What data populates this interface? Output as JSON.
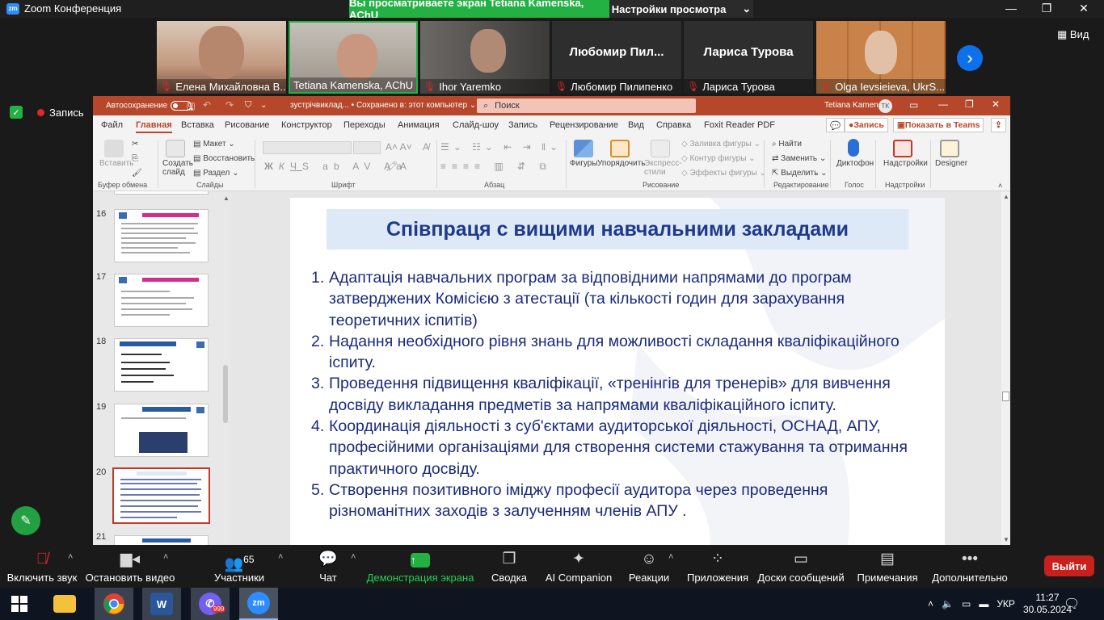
{
  "zoom": {
    "app_title": "Zoom Конференция",
    "share_banner": "Вы просматриваете экран Tetiana Kamenska, AChU",
    "view_settings": "Настройки просмотра",
    "view_button": "Вид",
    "recording": "Запись"
  },
  "participants": [
    {
      "name": "Елена Михайловна В...",
      "video": true,
      "bg": "#c9a58a"
    },
    {
      "name": "Tetiana Kamenska, AChU",
      "video": true,
      "bg": "#b9b0a0"
    },
    {
      "name": "Ihor Yaremko",
      "video": true,
      "bg": "#4d4a47"
    },
    {
      "name": "Любомир Пилипенко",
      "display": "Любомир  Пил...",
      "video": false
    },
    {
      "name": "Лариса Турова",
      "display": "Лариса Турова",
      "video": false
    },
    {
      "name": "Olga Ievsieieva, UkrS...",
      "video": true,
      "bg": "#c27a3d"
    }
  ],
  "ppt": {
    "autosave": "Автосохранение",
    "filename": "зустрічвиклад... • Сохранено в: этот компьютер",
    "search": "Поиск",
    "user": "Tetiana Kamenska",
    "initials": "TK",
    "tabs": [
      "Файл",
      "Главная",
      "Вставка",
      "Рисование",
      "Конструктор",
      "Переходы",
      "Анимация",
      "Слайд-шоу",
      "Запись",
      "Рецензирование",
      "Вид",
      "Справка",
      "Foxit Reader PDF"
    ],
    "record_btn": "Запись",
    "teams_btn": "Показать в Teams",
    "ribbon": {
      "paste": "Вставить",
      "clipboard": "Буфер обмена",
      "create_slide": "Создать слайд",
      "layout": "Макет",
      "restore": "Восстановить",
      "section": "Раздел",
      "slides": "Слайды",
      "font": "Шрифт",
      "paragraph": "Абзац",
      "shapes": "Фигуры",
      "arrange": "Упорядочить",
      "express_styles": "Экспресс-стили",
      "shape_fill": "Заливка фигуры",
      "shape_outline": "Контур фигуры",
      "shape_effects": "Эффекты фигуры",
      "drawing": "Рисование",
      "find": "Найти",
      "replace": "Заменить",
      "select": "Выделить",
      "editing": "Редактирование",
      "dictate": "Диктофон",
      "voice": "Голос",
      "addins": "Надстройки",
      "addins_group": "Надстройки",
      "designer": "Designer"
    },
    "thumbnails": [
      {
        "num": "16"
      },
      {
        "num": "17"
      },
      {
        "num": "18"
      },
      {
        "num": "19"
      },
      {
        "num": "20",
        "selected": true
      },
      {
        "num": "21"
      }
    ],
    "slide": {
      "title": "Співпраця с вищими навчальними закладами",
      "items": [
        {
          "n": "1.",
          "text": "Адаптація навчальних програм за відповідними напрямами до програм затверджених Комісією з атестації (та кількості годин для зарахування теоретичних іспитів)"
        },
        {
          "n": "2.",
          "text": "Надання необхідного рівня знань для можливості складання кваліфікаційного іспиту."
        },
        {
          "n": "3.",
          "text": "Проведення підвищення кваліфікації, «тренінгів для тренерів» для вивчення досвіду викладання предметів за напрямами кваліфікаційного іспиту."
        },
        {
          "n": "4.",
          "text": "Координація діяльності з суб'єктами аудиторської діяльності, ОСНАД, АПУ, професійними організаціями для створення системи стажування та отримання практичного досвіду."
        },
        {
          "n": "5.",
          "text": "Створення позитивного іміджу професії аудитора через проведення різноманітних заходів з залученням членів АПУ ."
        }
      ]
    }
  },
  "toolbar": {
    "unmute": "Включить звук",
    "video": "Остановить видео",
    "participants": "Участники",
    "participants_count": "65",
    "chat": "Чат",
    "share": "Демонстрация экрана",
    "summary": "Сводка",
    "ai": "AI Companion",
    "reactions": "Реакции",
    "apps": "Приложения",
    "whiteboards": "Доски сообщений",
    "notes": "Примечания",
    "more": "Дополнительно",
    "leave": "Выйти"
  },
  "taskbar": {
    "language": "УКР",
    "time": "11:27",
    "date": "30.05.2024",
    "viber_badge": "999",
    "word_letter": "W",
    "zoom_letters": "zm"
  }
}
